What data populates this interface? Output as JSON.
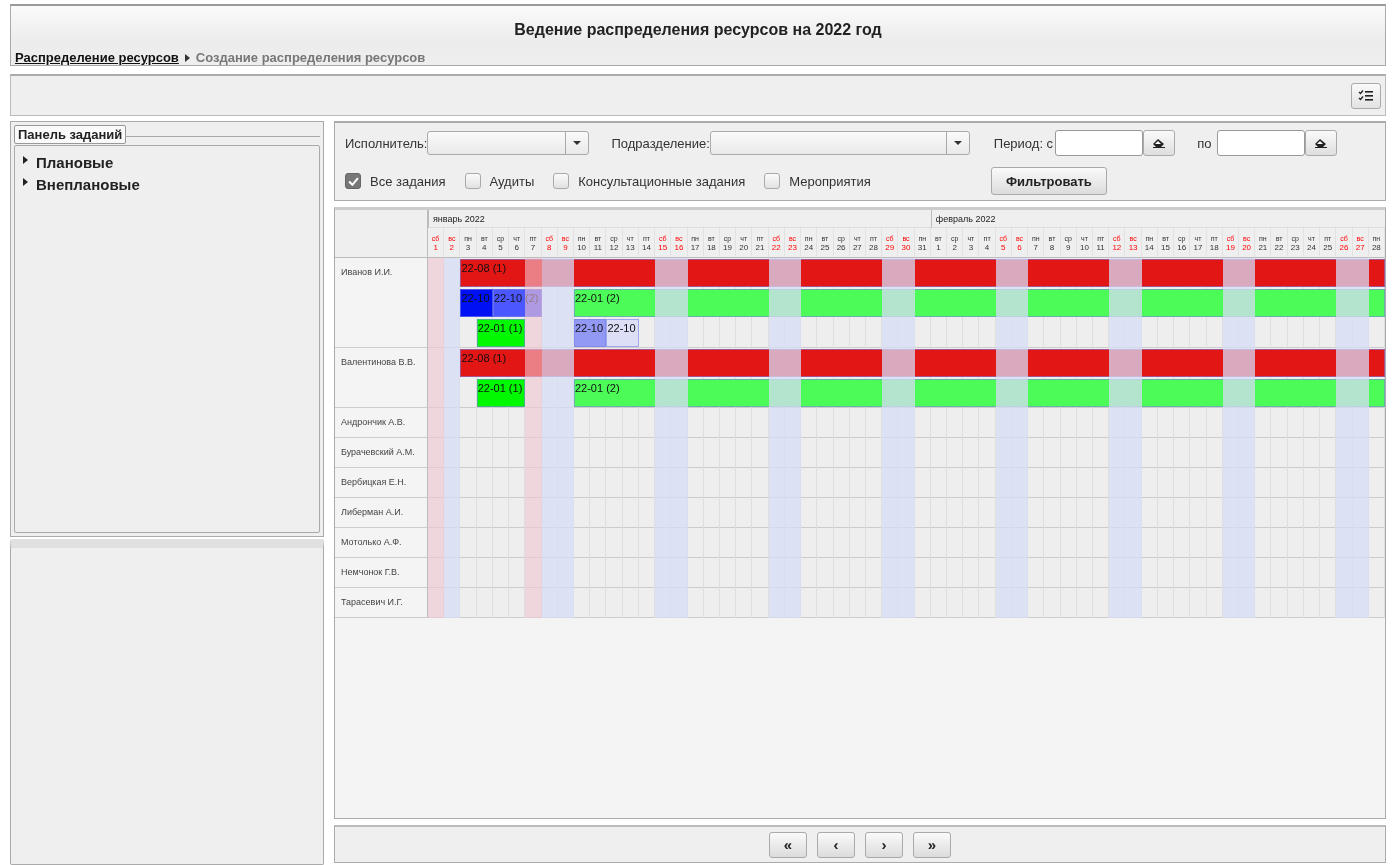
{
  "title": "Ведение распределения ресурсов на 2022 год",
  "breadcrumb": [
    {
      "label": "Распределение ресурсов",
      "link": true
    },
    {
      "label": "Создание распределения ресурсов",
      "link": false
    }
  ],
  "task_panel": {
    "title": "Панель заданий",
    "items": [
      {
        "label": "Плановые",
        "expanded": false
      },
      {
        "label": "Внеплановые",
        "expanded": false
      }
    ]
  },
  "filters": {
    "performer_label": "Исполнитель:",
    "department_label": "Подразделение:",
    "period_from_label": "Период: с",
    "period_to_label": "по",
    "checkboxes": [
      {
        "label": "Все задания",
        "checked": true
      },
      {
        "label": "Аудиты",
        "checked": false
      },
      {
        "label": "Консультационные задания",
        "checked": false
      },
      {
        "label": "Мероприятия",
        "checked": false
      }
    ],
    "filter_button": "Фильтровать"
  },
  "gantt": {
    "months": [
      {
        "label": "январь 2022",
        "days": [
          {
            "weekday": "сб",
            "day": "1",
            "weekend": true,
            "holiday": true
          },
          {
            "weekday": "вс",
            "day": "2",
            "weekend": true,
            "holiday": false
          },
          {
            "weekday": "пн",
            "day": "3",
            "weekend": false,
            "holiday": false
          },
          {
            "weekday": "вт",
            "day": "4",
            "weekend": false,
            "holiday": false
          },
          {
            "weekday": "ср",
            "day": "5",
            "weekend": false,
            "holiday": false
          },
          {
            "weekday": "чт",
            "day": "6",
            "weekend": false,
            "holiday": false
          },
          {
            "weekday": "пт",
            "day": "7",
            "weekend": false,
            "holiday": true
          },
          {
            "weekday": "сб",
            "day": "8",
            "weekend": true,
            "holiday": false
          },
          {
            "weekday": "вс",
            "day": "9",
            "weekend": true,
            "holiday": false
          },
          {
            "weekday": "пн",
            "day": "10",
            "weekend": false,
            "holiday": false
          },
          {
            "weekday": "вт",
            "day": "11",
            "weekend": false,
            "holiday": false
          },
          {
            "weekday": "ср",
            "day": "12",
            "weekend": false,
            "holiday": false
          },
          {
            "weekday": "чт",
            "day": "13",
            "weekend": false,
            "holiday": false
          },
          {
            "weekday": "пт",
            "day": "14",
            "weekend": false,
            "holiday": false
          },
          {
            "weekday": "сб",
            "day": "15",
            "weekend": true,
            "holiday": false
          },
          {
            "weekday": "вс",
            "day": "16",
            "weekend": true,
            "holiday": false
          },
          {
            "weekday": "пн",
            "day": "17",
            "weekend": false,
            "holiday": false
          },
          {
            "weekday": "вт",
            "day": "18",
            "weekend": false,
            "holiday": false
          },
          {
            "weekday": "ср",
            "day": "19",
            "weekend": false,
            "holiday": false
          },
          {
            "weekday": "чт",
            "day": "20",
            "weekend": false,
            "holiday": false
          },
          {
            "weekday": "пт",
            "day": "21",
            "weekend": false,
            "holiday": false
          },
          {
            "weekday": "сб",
            "day": "22",
            "weekend": true,
            "holiday": false
          },
          {
            "weekday": "вс",
            "day": "23",
            "weekend": true,
            "holiday": false
          },
          {
            "weekday": "пн",
            "day": "24",
            "weekend": false,
            "holiday": false
          },
          {
            "weekday": "вт",
            "day": "25",
            "weekend": false,
            "holiday": false
          },
          {
            "weekday": "ср",
            "day": "26",
            "weekend": false,
            "holiday": false
          },
          {
            "weekday": "чт",
            "day": "27",
            "weekend": false,
            "holiday": false
          },
          {
            "weekday": "пт",
            "day": "28",
            "weekend": false,
            "holiday": false
          },
          {
            "weekday": "сб",
            "day": "29",
            "weekend": true,
            "holiday": false
          },
          {
            "weekday": "вс",
            "day": "30",
            "weekend": true,
            "holiday": false
          },
          {
            "weekday": "пн",
            "day": "31",
            "weekend": false,
            "holiday": false
          }
        ]
      },
      {
        "label": "февраль 2022",
        "days": [
          {
            "weekday": "вт",
            "day": "1",
            "weekend": false,
            "holiday": false
          },
          {
            "weekday": "ср",
            "day": "2",
            "weekend": false,
            "holiday": false
          },
          {
            "weekday": "чт",
            "day": "3",
            "weekend": false,
            "holiday": false
          },
          {
            "weekday": "пт",
            "day": "4",
            "weekend": false,
            "holiday": false
          },
          {
            "weekday": "сб",
            "day": "5",
            "weekend": true,
            "holiday": false
          },
          {
            "weekday": "вс",
            "day": "6",
            "weekend": true,
            "holiday": false
          },
          {
            "weekday": "пн",
            "day": "7",
            "weekend": false,
            "holiday": false
          },
          {
            "weekday": "вт",
            "day": "8",
            "weekend": false,
            "holiday": false
          },
          {
            "weekday": "ср",
            "day": "9",
            "weekend": false,
            "holiday": false
          },
          {
            "weekday": "чт",
            "day": "10",
            "weekend": false,
            "holiday": false
          },
          {
            "weekday": "пт",
            "day": "11",
            "weekend": false,
            "holiday": false
          },
          {
            "weekday": "сб",
            "day": "12",
            "weekend": true,
            "holiday": false
          },
          {
            "weekday": "вс",
            "day": "13",
            "weekend": true,
            "holiday": false
          },
          {
            "weekday": "пн",
            "day": "14",
            "weekend": false,
            "holiday": false
          },
          {
            "weekday": "вт",
            "day": "15",
            "weekend": false,
            "holiday": false
          },
          {
            "weekday": "ср",
            "day": "16",
            "weekend": false,
            "holiday": false
          },
          {
            "weekday": "чт",
            "day": "17",
            "weekend": false,
            "holiday": false
          },
          {
            "weekday": "пт",
            "day": "18",
            "weekend": false,
            "holiday": false
          },
          {
            "weekday": "сб",
            "day": "19",
            "weekend": true,
            "holiday": false
          },
          {
            "weekday": "вс",
            "day": "20",
            "weekend": true,
            "holiday": false
          },
          {
            "weekday": "пн",
            "day": "21",
            "weekend": false,
            "holiday": false
          },
          {
            "weekday": "вт",
            "day": "22",
            "weekend": false,
            "holiday": false
          },
          {
            "weekday": "ср",
            "day": "23",
            "weekend": false,
            "holiday": false
          },
          {
            "weekday": "чт",
            "day": "24",
            "weekend": false,
            "holiday": false
          },
          {
            "weekday": "пт",
            "day": "25",
            "weekend": false,
            "holiday": false
          },
          {
            "weekday": "сб",
            "day": "26",
            "weekend": true,
            "holiday": false
          },
          {
            "weekday": "вс",
            "day": "27",
            "weekend": true,
            "holiday": false
          },
          {
            "weekday": "пн",
            "day": "28",
            "weekend": false,
            "holiday": false
          }
        ]
      }
    ],
    "rows": [
      {
        "name": "Иванов И.И.",
        "lanes": [
          [
            {
              "label": "22-08 (1)",
              "color": "#e31616"
            }
          ],
          [
            {
              "label": "22-10",
              "color": "#0010f5"
            },
            {
              "label": "22-10 (2)",
              "color": "#4d57ff"
            },
            {
              "label": "22-01 (2)",
              "color": "#4cfa58"
            }
          ],
          [
            {
              "label": "22-01 (1)",
              "color": "#00f800"
            },
            {
              "label": "22-10",
              "color": "#9199f5"
            },
            {
              "label": "22-10",
              "color": "#dcdff6"
            }
          ]
        ]
      },
      {
        "name": "Валентинова В.В.",
        "lanes": [
          [
            {
              "label": "22-08 (1)",
              "color": "#e31616"
            }
          ],
          [
            {
              "label": "22-01 (1)",
              "color": "#00f800"
            },
            {
              "label": "22-01 (2)",
              "color": "#4cfa58"
            }
          ]
        ]
      },
      {
        "name": "Андрончик А.В."
      },
      {
        "name": "Бурачевский А.М."
      },
      {
        "name": "Вербицкая Е.Н."
      },
      {
        "name": "Либерман А.И."
      },
      {
        "name": "Мотолько А.Ф."
      },
      {
        "name": "Немчонок Г.В."
      },
      {
        "name": "Тарасевич И.Г."
      }
    ]
  },
  "pager": [
    "«",
    "‹",
    "›",
    "»"
  ]
}
